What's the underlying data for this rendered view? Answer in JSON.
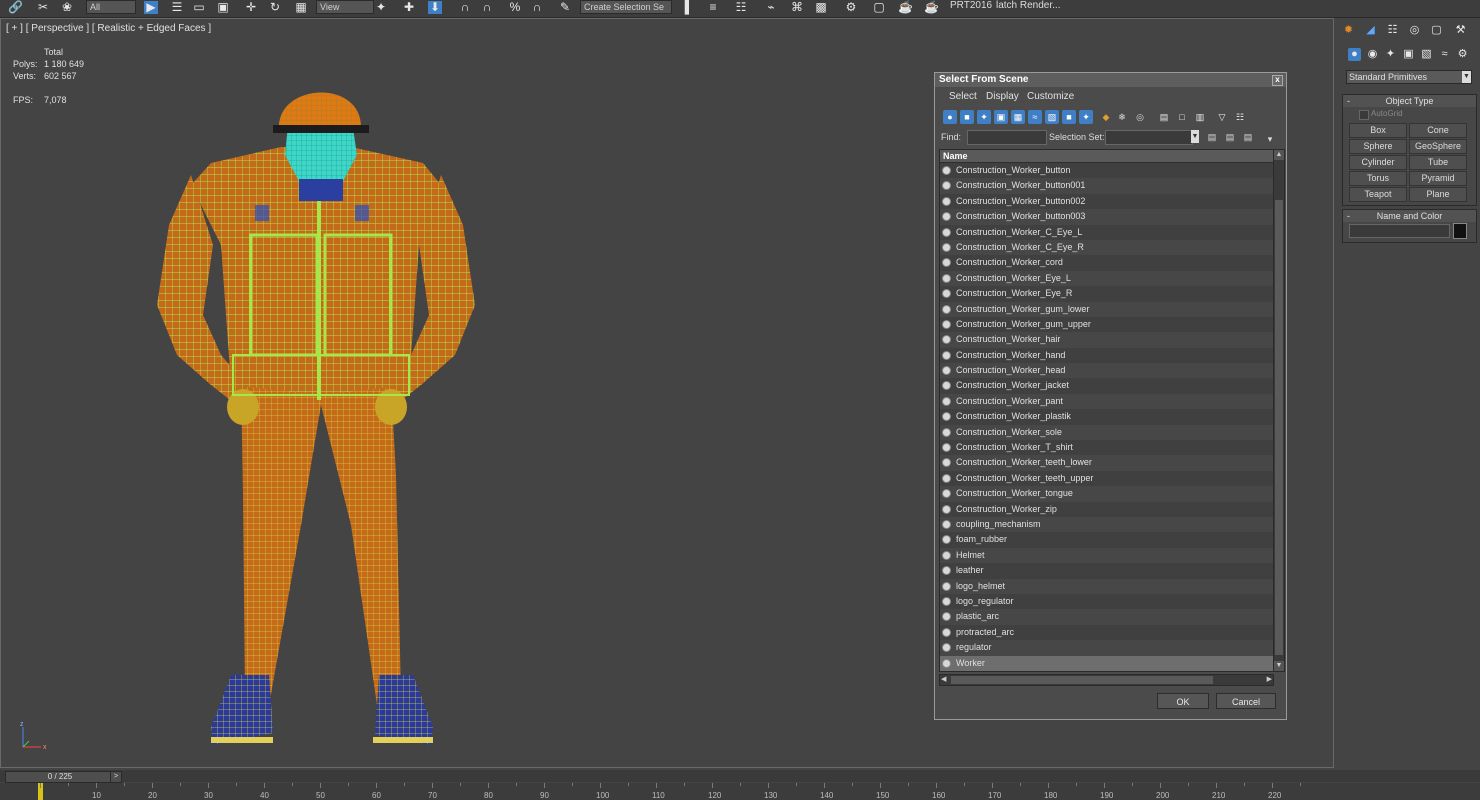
{
  "toolbar": {
    "dropdown_all": "All",
    "dropdown_view": "View",
    "selection_set": "Create Selection Se",
    "prt_label": "PRT2016",
    "batch_render": "latch Render..."
  },
  "viewport": {
    "label": "[ + ] [ Perspective ] [ Realistic + Edged Faces ]",
    "stats": {
      "header": "Total",
      "polys_label": "Polys:",
      "polys_value": "1 180 649",
      "verts_label": "Verts:",
      "verts_value": "602 567",
      "fps_label": "FPS:",
      "fps_value": "7,078"
    },
    "axis_labels": {
      "z": "z",
      "x": "x"
    }
  },
  "dialog": {
    "title": "Select From Scene",
    "close": "x",
    "menu": [
      "Select",
      "Display",
      "Customize"
    ],
    "find_label": "Find:",
    "find_value": "",
    "selection_set_label": "Selection Set:",
    "list_header": "Name",
    "items": [
      "Construction_Worker_button",
      "Construction_Worker_button001",
      "Construction_Worker_button002",
      "Construction_Worker_button003",
      "Construction_Worker_C_Eye_L",
      "Construction_Worker_C_Eye_R",
      "Construction_Worker_cord",
      "Construction_Worker_Eye_L",
      "Construction_Worker_Eye_R",
      "Construction_Worker_gum_lower",
      "Construction_Worker_gum_upper",
      "Construction_Worker_hair",
      "Construction_Worker_hand",
      "Construction_Worker_head",
      "Construction_Worker_jacket",
      "Construction_Worker_pant",
      "Construction_Worker_plastik",
      "Construction_Worker_sole",
      "Construction_Worker_T_shirt",
      "Construction_Worker_teeth_lower",
      "Construction_Worker_teeth_upper",
      "Construction_Worker_tongue",
      "Construction_Worker_zip",
      "coupling_mechanism",
      "foam_rubber",
      "Helmet",
      "leather",
      "logo_helmet",
      "logo_regulator",
      "plastic_arc",
      "protracted_arc",
      "regulator",
      "Worker"
    ],
    "selected_item": "Worker",
    "ok_label": "OK",
    "cancel_label": "Cancel"
  },
  "command_panel": {
    "category": "Standard Primitives",
    "object_type_title": "Object Type",
    "autogrid_label": "AutoGrid",
    "primitives": [
      "Box",
      "Cone",
      "Sphere",
      "GeoSphere",
      "Cylinder",
      "Tube",
      "Torus",
      "Pyramid",
      "Teapot",
      "Plane"
    ],
    "name_color_title": "Name and Color",
    "name_value": "",
    "object_color": "#111111"
  },
  "timeline": {
    "frame_indicator": "0 / 225",
    "next_label": ">",
    "ticks": [
      "10",
      "20",
      "30",
      "40",
      "50",
      "60",
      "70",
      "80",
      "90",
      "100",
      "110",
      "120",
      "130",
      "140",
      "150",
      "160",
      "170",
      "180",
      "190",
      "200",
      "210",
      "220"
    ]
  },
  "colors": {
    "viewport_bg": "#444444",
    "stats_text": "#e5d06e",
    "wire_green": "#a8e64a",
    "jacket_orange": "#c46a1a",
    "helmet_orange": "#e07a10",
    "skin_cyan": "#3cd7c6",
    "boot_blue": "#2b3a9a",
    "time_cursor": "#d7c21a"
  }
}
